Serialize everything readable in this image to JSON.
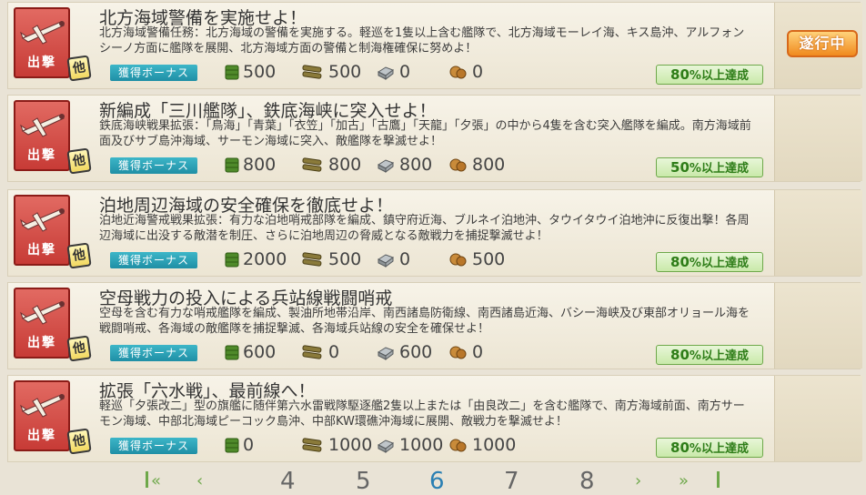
{
  "colors": {
    "accent_bonus": "#1f8fa5",
    "progress_green": "#2e7d18",
    "badge_red": "#c73b36",
    "ongoing_orange": "#f08a1e",
    "active_page": "#2a7fb3"
  },
  "category_label": "出撃",
  "sub_badge": "他",
  "bonus_label": "獲得ボーナス",
  "icons": {
    "fuel": "fuel-drum-icon",
    "ammo": "ammo-icon",
    "steel": "steel-icon",
    "bauxite": "bauxite-icon",
    "plane": "plane-icon"
  },
  "quests": [
    {
      "title": "北方海域警備を実施せよ！",
      "desc": "北方海域警備任務：北方海域の警備を実施する。軽巡を1隻以上含む艦隊で、北方海域モーレイ海、キス島沖、アルフォンシーノ方面に艦隊を展開、北方海域方面の警備と制海権確保に努めよ！",
      "fuel": "500",
      "ammo": "500",
      "steel": "0",
      "bauxite": "0",
      "progress_pct": "80",
      "progress_suffix": "%以上達成",
      "status": "遂行中"
    },
    {
      "title": "新編成「三川艦隊」、鉄底海峡に突入せよ！",
      "desc": "鉄底海峡戦果拡張：「鳥海」「青葉」「衣笠」「加古」「古鷹」「天龍」「夕張」の中から4隻を含む突入艦隊を編成。南方海域前面及びサブ島沖海域、サーモン海域に突入、敵艦隊を撃滅せよ！",
      "fuel": "800",
      "ammo": "800",
      "steel": "800",
      "bauxite": "800",
      "progress_pct": "50",
      "progress_suffix": "%以上達成",
      "status": ""
    },
    {
      "title": "泊地周辺海域の安全確保を徹底せよ！",
      "desc": "泊地近海警戒戦果拡張：有力な泊地哨戒部隊を編成、鎮守府近海、ブルネイ泊地沖、タウイタウイ泊地沖に反復出撃！各周辺海域に出没する敵潜を制圧、さらに泊地周辺の脅威となる敵戦力を捕捉撃滅せよ！",
      "fuel": "2000",
      "ammo": "500",
      "steel": "0",
      "bauxite": "500",
      "progress_pct": "80",
      "progress_suffix": "%以上達成",
      "status": ""
    },
    {
      "title": "空母戦力の投入による兵站線戦闘哨戒",
      "desc": "空母を含む有力な哨戒艦隊を編成、製油所地帯沿岸、南西諸島防衛線、南西諸島近海、バシー海峡及び東部オリョール海を戦闘哨戒、各海域の敵艦隊を捕捉撃滅、各海域兵站線の安全を確保せよ！",
      "fuel": "600",
      "ammo": "0",
      "steel": "600",
      "bauxite": "0",
      "progress_pct": "80",
      "progress_suffix": "%以上達成",
      "status": ""
    },
    {
      "title": "拡張「六水戦」、最前線へ！",
      "desc": "軽巡「夕張改二」型の旗艦に随伴第六水雷戦隊駆逐艦2隻以上または「由良改二」を含む艦隊で、南方海域前面、南方サーモン海域、中部北海域ピーコック島沖、中部KW環礁沖海域に展開、敵戦力を撃滅せよ！",
      "fuel": "0",
      "ammo": "1000",
      "steel": "1000",
      "bauxite": "1000",
      "progress_pct": "80",
      "progress_suffix": "%以上達成",
      "status": ""
    }
  ],
  "pager": {
    "pages": [
      "4",
      "5",
      "6",
      "7",
      "8"
    ],
    "active": "6"
  }
}
